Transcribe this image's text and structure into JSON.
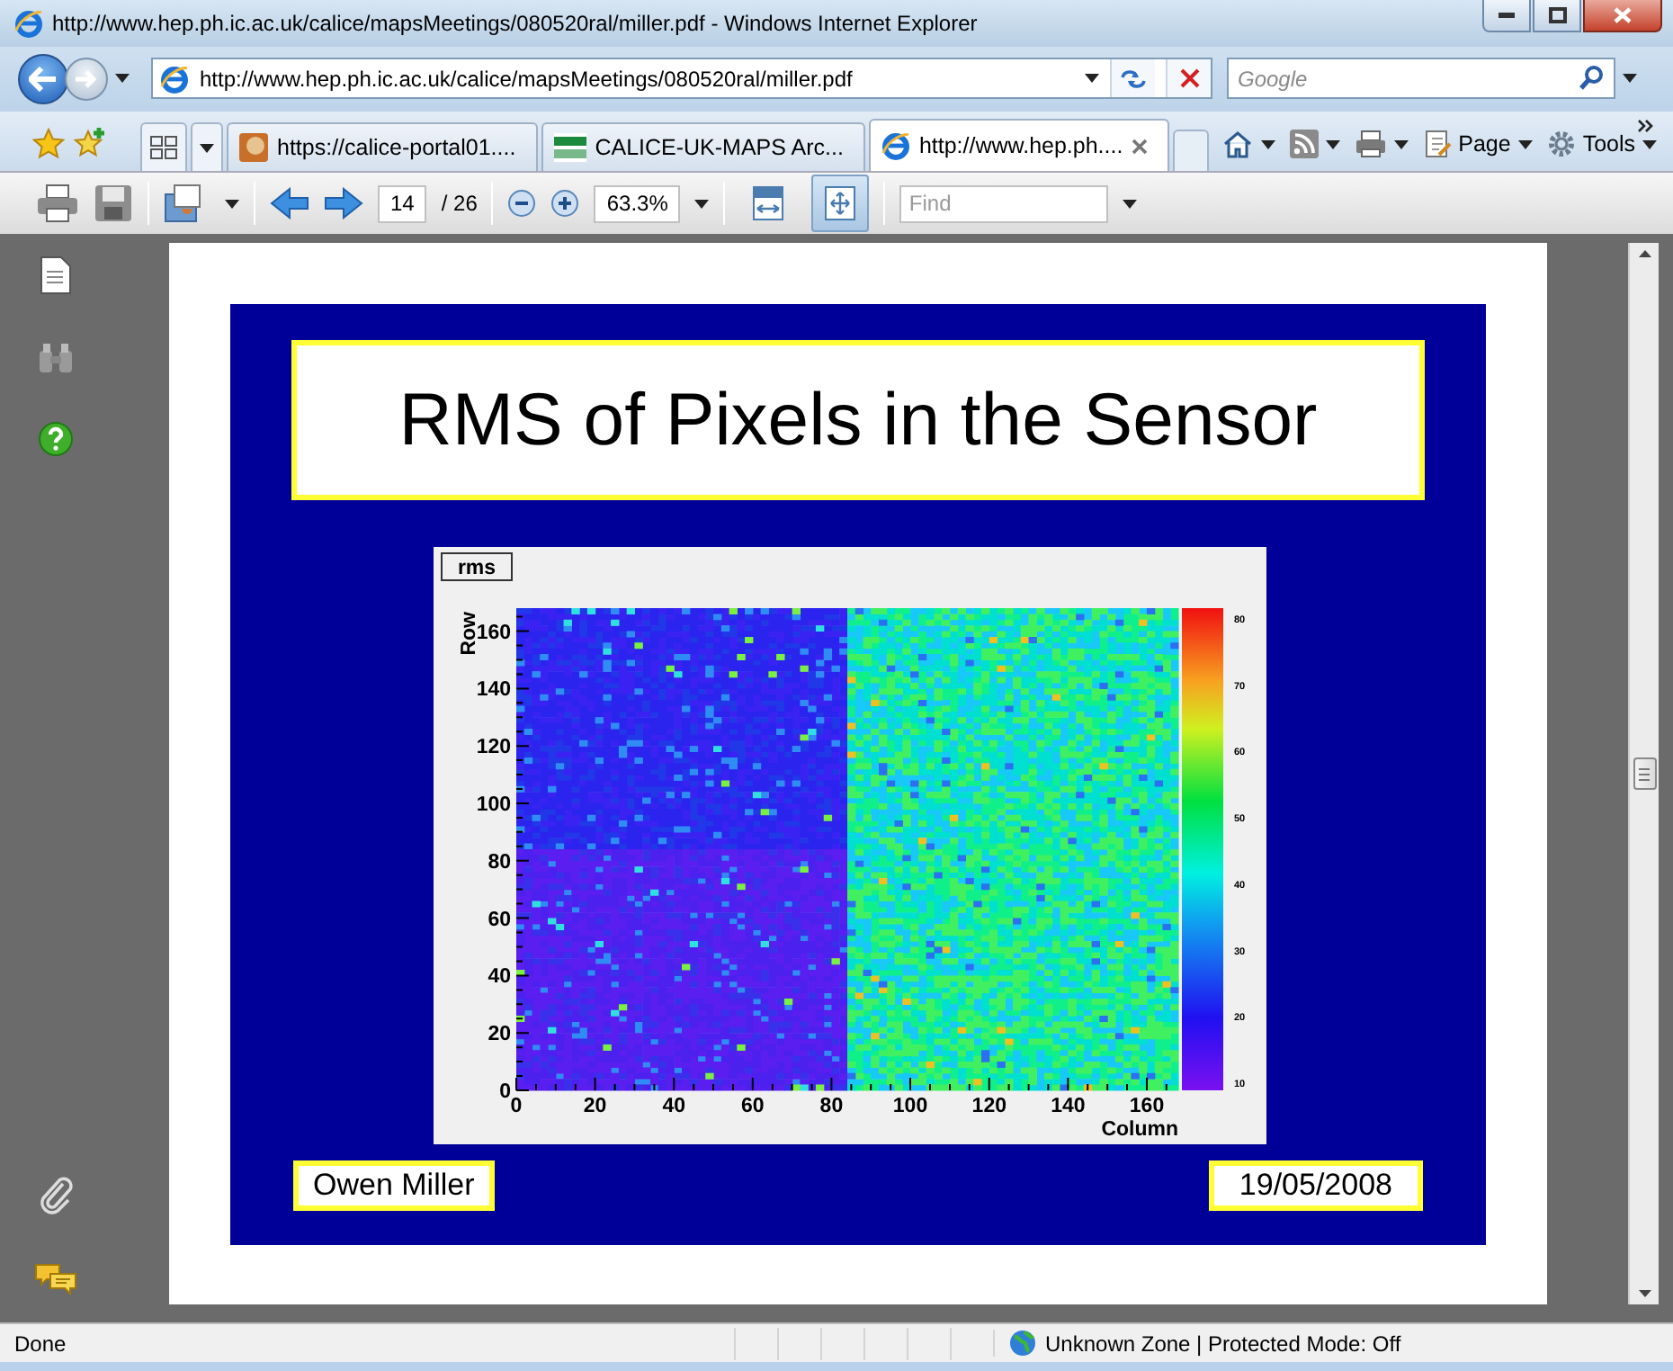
{
  "window": {
    "title": "http://www.hep.ph.ic.ac.uk/calice/mapsMeetings/080520ral/miller.pdf - Windows Internet Explorer"
  },
  "address_bar": {
    "value": "http://www.hep.ph.ic.ac.uk/calice/mapsMeetings/080520ral/miller.pdf"
  },
  "search": {
    "placeholder": "Google"
  },
  "tabs": [
    {
      "label": "https://calice-portal01....",
      "selected": false
    },
    {
      "label": "CALICE-UK-MAPS Arc...",
      "selected": false
    },
    {
      "label": "http://www.hep.ph....",
      "selected": true
    }
  ],
  "command_bar": [
    "Page",
    "Tools"
  ],
  "pdf_toolbar": {
    "page": "14",
    "page_count": "/ 26",
    "zoom": "63.3%",
    "find_placeholder": "Find",
    "view_buttons": [
      {
        "selected": false
      },
      {
        "selected": true
      }
    ]
  },
  "slide": {
    "title": "RMS of Pixels in the Sensor",
    "author": "Owen Miller",
    "date": "19/05/2008",
    "plot": {
      "stats_label": "rms",
      "ylabel": "Row",
      "xlabel": "Column",
      "yticks": [
        "160",
        "140",
        "120",
        "100",
        "80",
        "60",
        "40",
        "20",
        "0"
      ],
      "xticks": [
        "0",
        "20",
        "40",
        "60",
        "80",
        "100",
        "120",
        "140",
        "160"
      ],
      "colorbar_ticks": [
        "80",
        "70",
        "60",
        "50",
        "40",
        "30",
        "20",
        "10"
      ]
    }
  },
  "status_bar": {
    "status": "Done",
    "zone": "Unknown Zone | Protected Mode: Off"
  }
}
